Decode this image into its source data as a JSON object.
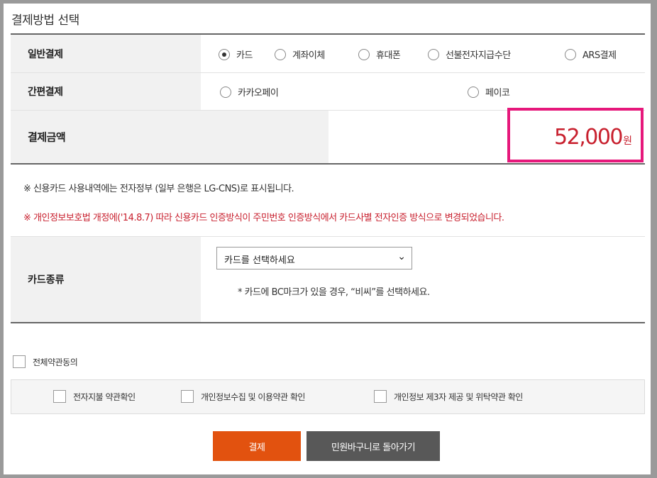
{
  "section_title": "결제방법 선택",
  "general_payment": {
    "label": "일반결제",
    "options": [
      "카드",
      "계좌이체",
      "휴대폰",
      "선불전자지급수단",
      "ARS결제"
    ],
    "selected": "카드"
  },
  "simple_payment": {
    "label": "간편결제",
    "options": [
      "카카오페이",
      "페이코"
    ]
  },
  "amount": {
    "label": "결제금액",
    "value": "52,000",
    "unit": "원",
    "highlight_color": "#e6187b",
    "value_color": "#c8202e"
  },
  "notices": {
    "line1": "※ 신용카드 사용내역에는 전자정부 (일부 은행은 LG-CNS)로 표시됩니다.",
    "line2": "※ 개인정보보호법 개정에('14.8.7) 따라 신용카드 인증방식이 주민번호 인증방식에서 카드사별 전자인증 방식으로 변경되었습니다."
  },
  "card_type": {
    "label": "카드종류",
    "select_value": "카드를 선택하세요",
    "note": "* 카드에 BC마크가 있을 경우, “비씨”를 선택하세요."
  },
  "terms": {
    "agree_all": "전체약관동의",
    "items": [
      "전자지불 약관확인",
      "개인정보수집 및 이용약관 확인",
      "개인정보 제3자 제공 및 위탁약관 확인"
    ]
  },
  "buttons": {
    "pay": "결제",
    "back": "민원바구니로 돌아가기",
    "pay_color": "#e2520f",
    "back_color": "#585858"
  }
}
